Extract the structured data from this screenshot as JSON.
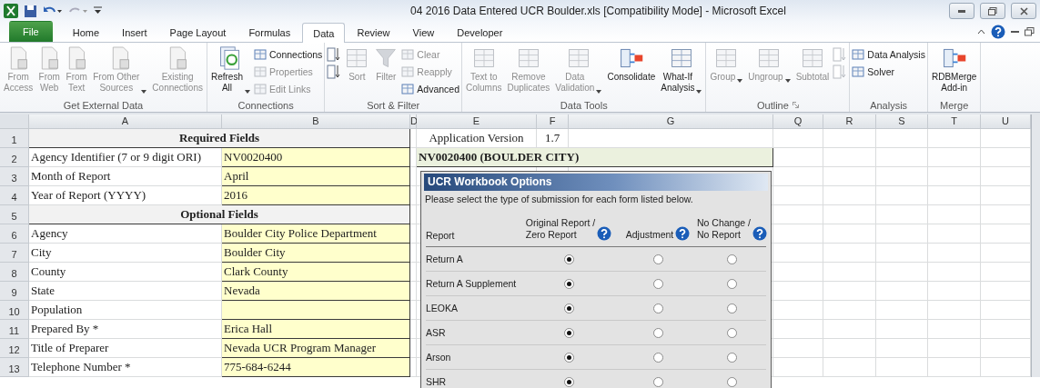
{
  "title_bar": {
    "title": "04 2016 Data Entered UCR Boulder.xls  [Compatibility Mode]  -  Microsoft Excel"
  },
  "tabs": [
    {
      "label": "File",
      "kind": "file",
      "selected": false
    },
    {
      "label": "Home",
      "kind": "tab",
      "selected": false
    },
    {
      "label": "Insert",
      "kind": "tab",
      "selected": false
    },
    {
      "label": "Page Layout",
      "kind": "tab",
      "selected": false
    },
    {
      "label": "Formulas",
      "kind": "tab",
      "selected": false
    },
    {
      "label": "Data",
      "kind": "tab",
      "selected": true
    },
    {
      "label": "Review",
      "kind": "tab",
      "selected": false
    },
    {
      "label": "View",
      "kind": "tab",
      "selected": false
    },
    {
      "label": "Developer",
      "kind": "tab",
      "selected": false
    }
  ],
  "ribbon": [
    {
      "label": "Get External Data",
      "launcher": false,
      "items": [
        {
          "kind": "large",
          "label": "From\nAccess",
          "disabled": true,
          "dropdown": false
        },
        {
          "kind": "large",
          "label": "From\nWeb",
          "disabled": true,
          "dropdown": false
        },
        {
          "kind": "large",
          "label": "From\nText",
          "disabled": true,
          "dropdown": false
        },
        {
          "kind": "large",
          "label": "From Other\nSources",
          "disabled": true,
          "dropdown": true
        },
        {
          "kind": "large",
          "label": "Existing\nConnections",
          "disabled": true,
          "dropdown": false
        }
      ]
    },
    {
      "label": "Connections",
      "launcher": false,
      "items": [
        {
          "kind": "large",
          "label": "Refresh\nAll",
          "disabled": false,
          "dropdown": true
        },
        {
          "kind": "stack",
          "children": [
            {
              "label": "Connections",
              "disabled": false
            },
            {
              "label": "Properties",
              "disabled": true
            },
            {
              "label": "Edit Links",
              "disabled": true
            }
          ]
        }
      ]
    },
    {
      "label": "Sort & Filter",
      "launcher": false,
      "items": [
        {
          "kind": "stack",
          "children": [
            {
              "disabled": false
            },
            {
              "disabled": false
            }
          ]
        },
        {
          "kind": "large",
          "label": "Sort",
          "disabled": true,
          "dropdown": false
        },
        {
          "kind": "large",
          "label": "Filter",
          "disabled": true,
          "dropdown": false
        },
        {
          "kind": "stack",
          "children": [
            {
              "label": "Clear",
              "disabled": true
            },
            {
              "label": "Reapply",
              "disabled": true
            },
            {
              "label": "Advanced",
              "disabled": false
            }
          ]
        }
      ]
    },
    {
      "label": "Data Tools",
      "launcher": false,
      "items": [
        {
          "kind": "large",
          "label": "Text to\nColumns",
          "disabled": true,
          "dropdown": false
        },
        {
          "kind": "large",
          "label": "Remove\nDuplicates",
          "disabled": true,
          "dropdown": false
        },
        {
          "kind": "large",
          "label": "Data\nValidation",
          "disabled": true,
          "dropdown": true
        },
        {
          "kind": "large",
          "label": "Consolidate",
          "disabled": false,
          "dropdown": false
        },
        {
          "kind": "large",
          "label": "What-If\nAnalysis",
          "disabled": false,
          "dropdown": true
        }
      ]
    },
    {
      "label": "Outline",
      "launcher": true,
      "items": [
        {
          "kind": "large",
          "label": "Group",
          "disabled": true,
          "dropdown": true
        },
        {
          "kind": "large",
          "label": "Ungroup",
          "disabled": true,
          "dropdown": true
        },
        {
          "kind": "large",
          "label": "Subtotal",
          "disabled": true,
          "dropdown": false
        },
        {
          "kind": "stack",
          "children": [
            {
              "disabled": true
            },
            {
              "disabled": true
            }
          ]
        }
      ]
    },
    {
      "label": "Analysis",
      "launcher": false,
      "items": [
        {
          "kind": "stack",
          "children": [
            {
              "label": "Data Analysis",
              "disabled": false
            },
            {
              "label": "Solver",
              "disabled": false
            }
          ]
        }
      ]
    },
    {
      "label": "Merge",
      "launcher": false,
      "items": [
        {
          "kind": "large",
          "label": "RDBMerge\nAdd-in",
          "disabled": false,
          "dropdown": false
        }
      ]
    }
  ],
  "sheet": {
    "columns": [
      "A",
      "B",
      "D",
      "E",
      "F",
      "G",
      "Q",
      "R",
      "S",
      "T",
      "U"
    ],
    "rows": [
      {
        "number": "1",
        "kind": "section",
        "label": "Required Fields"
      },
      {
        "number": "2",
        "kind": "field",
        "label": "Agency Identifier (7 or 9 digit ORI)",
        "value": "NV0020400"
      },
      {
        "number": "3",
        "kind": "field",
        "label": "Month of Report",
        "value": "April"
      },
      {
        "number": "4",
        "kind": "field",
        "label": "Year of Report (YYYY)",
        "value": "2016"
      },
      {
        "number": "5",
        "kind": "section",
        "label": "Optional Fields"
      },
      {
        "number": "6",
        "kind": "field",
        "label": "Agency",
        "value": "Boulder City Police Department"
      },
      {
        "number": "7",
        "kind": "field",
        "label": "City",
        "value": "Boulder City"
      },
      {
        "number": "8",
        "kind": "field",
        "label": "County",
        "value": "Clark County"
      },
      {
        "number": "9",
        "kind": "field",
        "label": "State",
        "value": "Nevada"
      },
      {
        "number": "10",
        "kind": "field",
        "label": "Population"
      },
      {
        "number": "11",
        "kind": "field",
        "label": "Prepared By *",
        "value": "Erica Hall"
      },
      {
        "number": "12",
        "kind": "field",
        "label": "Title of Preparer",
        "value": "Nevada UCR Program Manager"
      },
      {
        "number": "13",
        "kind": "field",
        "label": "Telephone Number *",
        "value": "775-684-6244"
      }
    ],
    "info": {
      "label": "Application Version",
      "value": "1.7",
      "banner": "NV0020400 (BOULDER CITY)"
    }
  },
  "dialog": {
    "title": "UCR Workbook Options",
    "instruction": "Please select the type of submission for each form listed below.",
    "report_header": "Report",
    "options": [
      "Original Report /\nZero Report",
      "Adjustment",
      "No Change /\nNo Report"
    ],
    "rows": [
      {
        "report": "Return A",
        "choices": [
          {
            "selected": true
          },
          {
            "selected": false
          },
          {
            "selected": false
          }
        ]
      },
      {
        "report": "Return A Supplement",
        "choices": [
          {
            "selected": true
          },
          {
            "selected": false
          },
          {
            "selected": false
          }
        ]
      },
      {
        "report": "LEOKA",
        "choices": [
          {
            "selected": true
          },
          {
            "selected": false
          },
          {
            "selected": false
          }
        ]
      },
      {
        "report": "ASR",
        "choices": [
          {
            "selected": true
          },
          {
            "selected": false
          },
          {
            "selected": false
          }
        ]
      },
      {
        "report": "Arson",
        "choices": [
          {
            "selected": true
          },
          {
            "selected": false
          },
          {
            "selected": false
          }
        ]
      },
      {
        "report": "SHR",
        "choices": [
          {
            "selected": true
          },
          {
            "selected": false
          },
          {
            "selected": false
          }
        ]
      }
    ]
  }
}
